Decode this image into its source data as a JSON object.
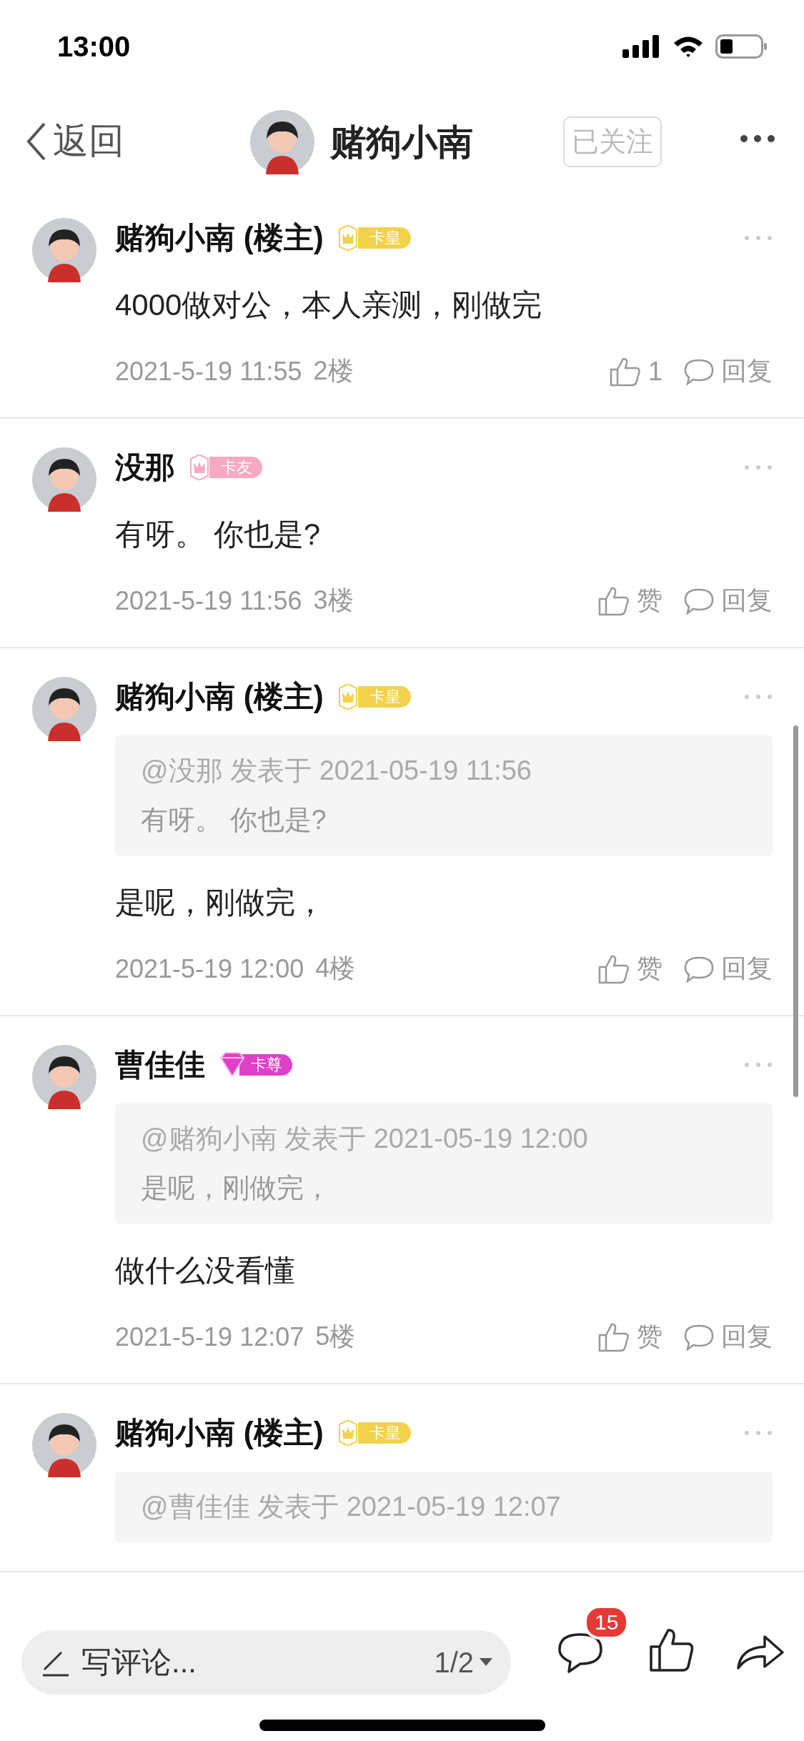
{
  "status_bar": {
    "time": "13:00"
  },
  "nav": {
    "back_label": "返回",
    "title": "赌狗小南",
    "follow_label": "已关注"
  },
  "posts": [
    {
      "name": "赌狗小南 (楼主)",
      "badge": {
        "kind": "crown",
        "color": "#f2d24a",
        "label": "卡皇"
      },
      "content": "4000做对公，本人亲测，刚做完",
      "time": "2021-5-19 11:55",
      "floor": "2楼",
      "like_label": "1",
      "reply_label": "回复"
    },
    {
      "name": "没那",
      "badge": {
        "kind": "crown",
        "color": "#f5a9c4",
        "label": "卡友"
      },
      "content": "有呀。 你也是?",
      "time": "2021-5-19 11:56",
      "floor": "3楼",
      "like_label": "赞",
      "reply_label": "回复"
    },
    {
      "name": "赌狗小南 (楼主)",
      "badge": {
        "kind": "crown",
        "color": "#f2d24a",
        "label": "卡皇"
      },
      "quote": {
        "meta": "@没那 发表于 2021-05-19 11:56",
        "text": "有呀。 你也是?"
      },
      "content": "是呢，刚做完，",
      "time": "2021-5-19 12:00",
      "floor": "4楼",
      "like_label": "赞",
      "reply_label": "回复"
    },
    {
      "name": "曹佳佳",
      "badge": {
        "kind": "diamond",
        "color": "#e040c8",
        "label": "卡尊"
      },
      "quote": {
        "meta": "@赌狗小南 发表于 2021-05-19 12:00",
        "text": "是呢，刚做完，"
      },
      "content": "做什么没看懂",
      "time": "2021-5-19 12:07",
      "floor": "5楼",
      "like_label": "赞",
      "reply_label": "回复"
    },
    {
      "name": "赌狗小南 (楼主)",
      "badge": {
        "kind": "crown",
        "color": "#f2d24a",
        "label": "卡皇"
      },
      "quote": {
        "meta": "@曹佳佳 发表于 2021-05-19 12:07"
      }
    }
  ],
  "bottom_bar": {
    "placeholder": "写评论...",
    "page": "1/2",
    "comment_count": "15"
  }
}
